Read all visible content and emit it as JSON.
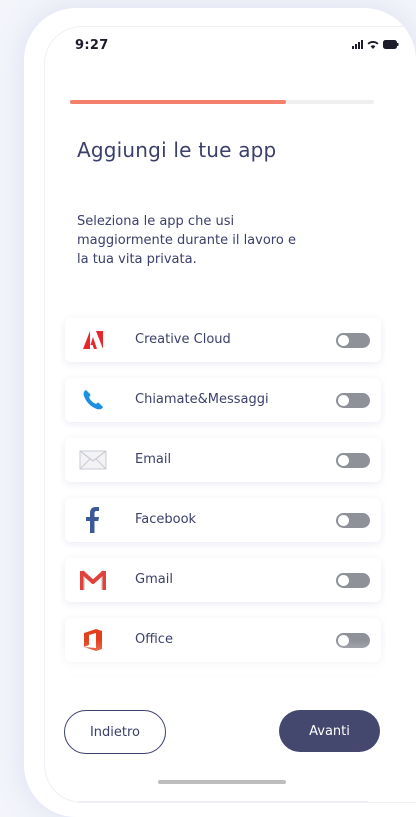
{
  "status_bar": {
    "time": "9:27"
  },
  "progress": {
    "value": 0.71
  },
  "page": {
    "title": "Aggiungi le tue app",
    "description": "Seleziona le app che usi maggiormente durante il lavoro e la tua vita privata."
  },
  "apps": [
    {
      "label": "Creative Cloud",
      "icon": "adobe-icon",
      "enabled": false
    },
    {
      "label": "Chiamate&Messaggi",
      "icon": "phone-icon",
      "enabled": false
    },
    {
      "label": "Email",
      "icon": "mail-icon",
      "enabled": false
    },
    {
      "label": "Facebook",
      "icon": "facebook-icon",
      "enabled": false
    },
    {
      "label": "Gmail",
      "icon": "gmail-icon",
      "enabled": false
    },
    {
      "label": "Office",
      "icon": "office-icon",
      "enabled": false
    }
  ],
  "footer": {
    "back_label": "Indietro",
    "next_label": "Avanti"
  },
  "colors": {
    "accent": "#f37f6d",
    "primary": "#44486f",
    "text": "#3b3f6b"
  }
}
